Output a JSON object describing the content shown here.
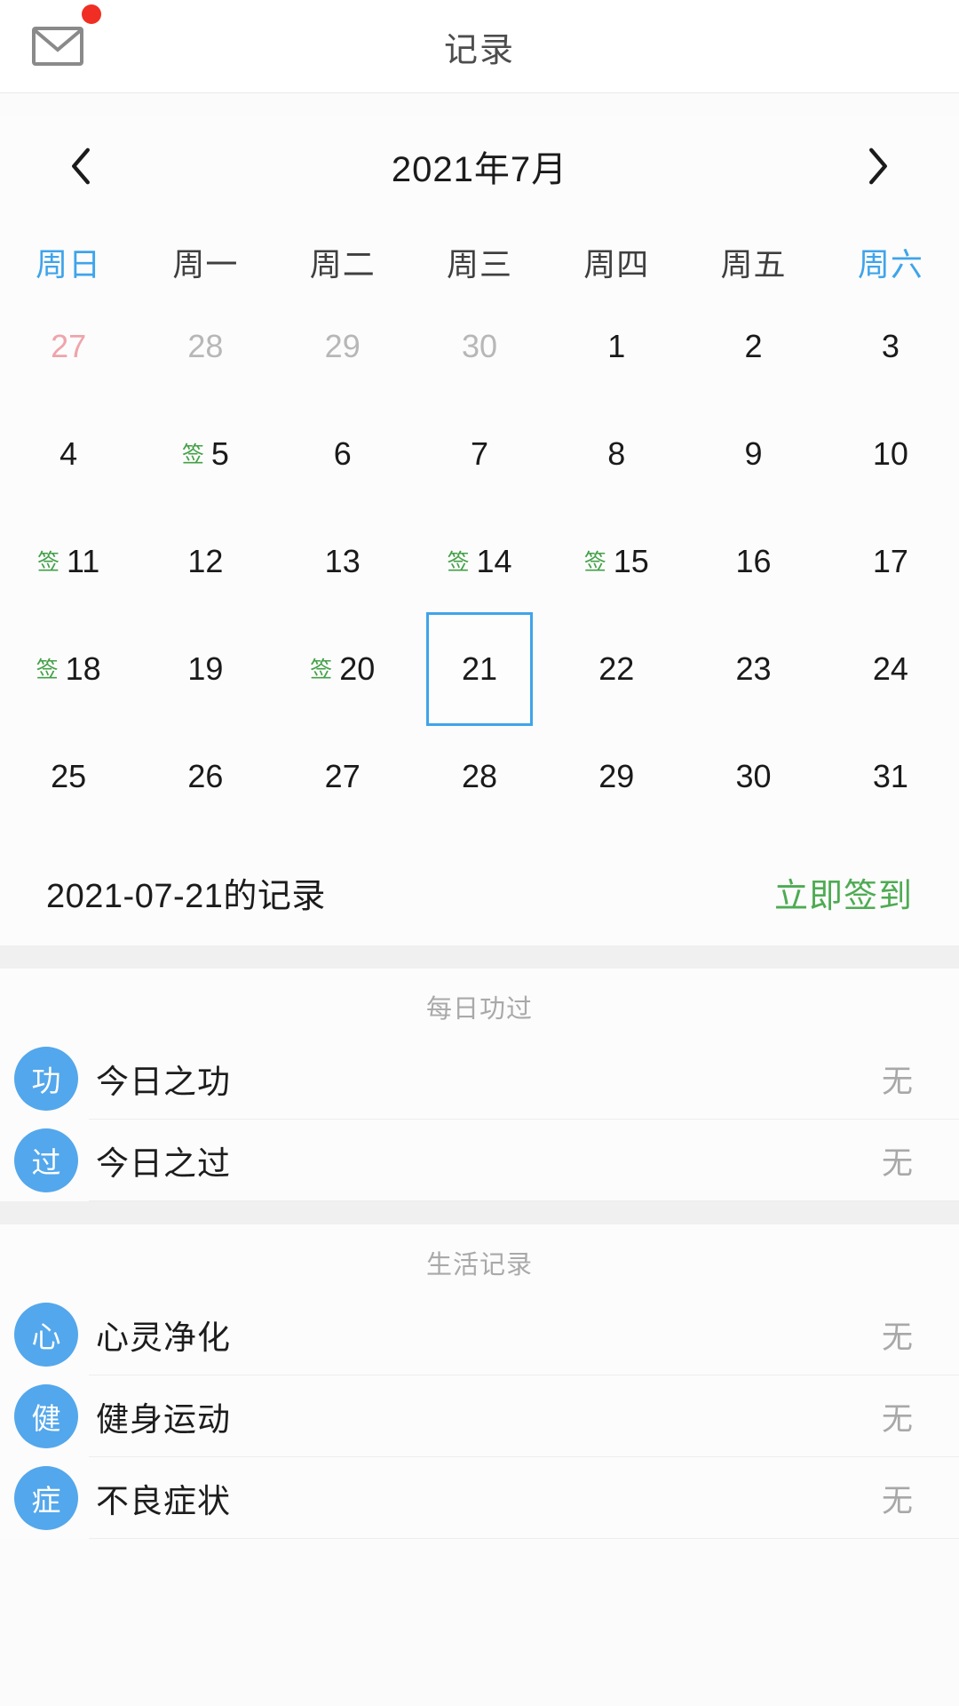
{
  "header": {
    "title": "记录",
    "mail_icon": "mail-envelope-icon",
    "badge": ""
  },
  "calendar": {
    "prev_label": "‹",
    "next_label": "›",
    "month_title": "2021年7月",
    "weekdays": [
      {
        "label": "周日",
        "accent": true
      },
      {
        "label": "周一",
        "accent": false
      },
      {
        "label": "周二",
        "accent": false
      },
      {
        "label": "周三",
        "accent": false
      },
      {
        "label": "周四",
        "accent": false
      },
      {
        "label": "周五",
        "accent": false
      },
      {
        "label": "周六",
        "accent": true
      }
    ],
    "sign_mark": "签",
    "selected_day": 21,
    "weeks": [
      [
        {
          "day": "27",
          "state": "prev-sunday",
          "signed": false
        },
        {
          "day": "28",
          "state": "prev",
          "signed": false
        },
        {
          "day": "29",
          "state": "prev",
          "signed": false
        },
        {
          "day": "30",
          "state": "prev",
          "signed": false
        },
        {
          "day": "1",
          "state": "current",
          "signed": false
        },
        {
          "day": "2",
          "state": "current",
          "signed": false
        },
        {
          "day": "3",
          "state": "current",
          "signed": false
        }
      ],
      [
        {
          "day": "4",
          "state": "current",
          "signed": false
        },
        {
          "day": "5",
          "state": "current",
          "signed": true
        },
        {
          "day": "6",
          "state": "current",
          "signed": false
        },
        {
          "day": "7",
          "state": "current",
          "signed": false
        },
        {
          "day": "8",
          "state": "current",
          "signed": false
        },
        {
          "day": "9",
          "state": "current",
          "signed": false
        },
        {
          "day": "10",
          "state": "current",
          "signed": false
        }
      ],
      [
        {
          "day": "11",
          "state": "current",
          "signed": true
        },
        {
          "day": "12",
          "state": "current",
          "signed": false
        },
        {
          "day": "13",
          "state": "current",
          "signed": false
        },
        {
          "day": "14",
          "state": "current",
          "signed": true
        },
        {
          "day": "15",
          "state": "current",
          "signed": true
        },
        {
          "day": "16",
          "state": "current",
          "signed": false
        },
        {
          "day": "17",
          "state": "current",
          "signed": false
        }
      ],
      [
        {
          "day": "18",
          "state": "current",
          "signed": true
        },
        {
          "day": "19",
          "state": "current",
          "signed": false
        },
        {
          "day": "20",
          "state": "current",
          "signed": true
        },
        {
          "day": "21",
          "state": "current",
          "signed": false,
          "selected": true
        },
        {
          "day": "22",
          "state": "current",
          "signed": false
        },
        {
          "day": "23",
          "state": "current",
          "signed": false
        },
        {
          "day": "24",
          "state": "current",
          "signed": false
        }
      ],
      [
        {
          "day": "25",
          "state": "current",
          "signed": false
        },
        {
          "day": "26",
          "state": "current",
          "signed": false
        },
        {
          "day": "27",
          "state": "current",
          "signed": false
        },
        {
          "day": "28",
          "state": "current",
          "signed": false
        },
        {
          "day": "29",
          "state": "current",
          "signed": false
        },
        {
          "day": "30",
          "state": "current",
          "signed": false
        },
        {
          "day": "31",
          "state": "current",
          "signed": false
        }
      ]
    ]
  },
  "record_bar": {
    "date_label": "2021-07-21的记录",
    "signin_label": "立即签到"
  },
  "sections": [
    {
      "title": "每日功过",
      "items": [
        {
          "avatar": "功",
          "label": "今日之功",
          "value": "无"
        },
        {
          "avatar": "过",
          "label": "今日之过",
          "value": "无"
        }
      ]
    },
    {
      "title": "生活记录",
      "items": [
        {
          "avatar": "心",
          "label": "心灵净化",
          "value": "无"
        },
        {
          "avatar": "健",
          "label": "健身运动",
          "value": "无"
        },
        {
          "avatar": "症",
          "label": "不良症状",
          "value": "无"
        }
      ]
    }
  ],
  "colors": {
    "accent_blue": "#3fa4ea",
    "avatar_blue": "#53a7ec",
    "sign_green": "#43a047",
    "link_green": "#4eab52",
    "badge_red": "#f12e23",
    "prev_sunday_pink": "#efa4ab",
    "muted_gray": "#b7b7b7"
  }
}
